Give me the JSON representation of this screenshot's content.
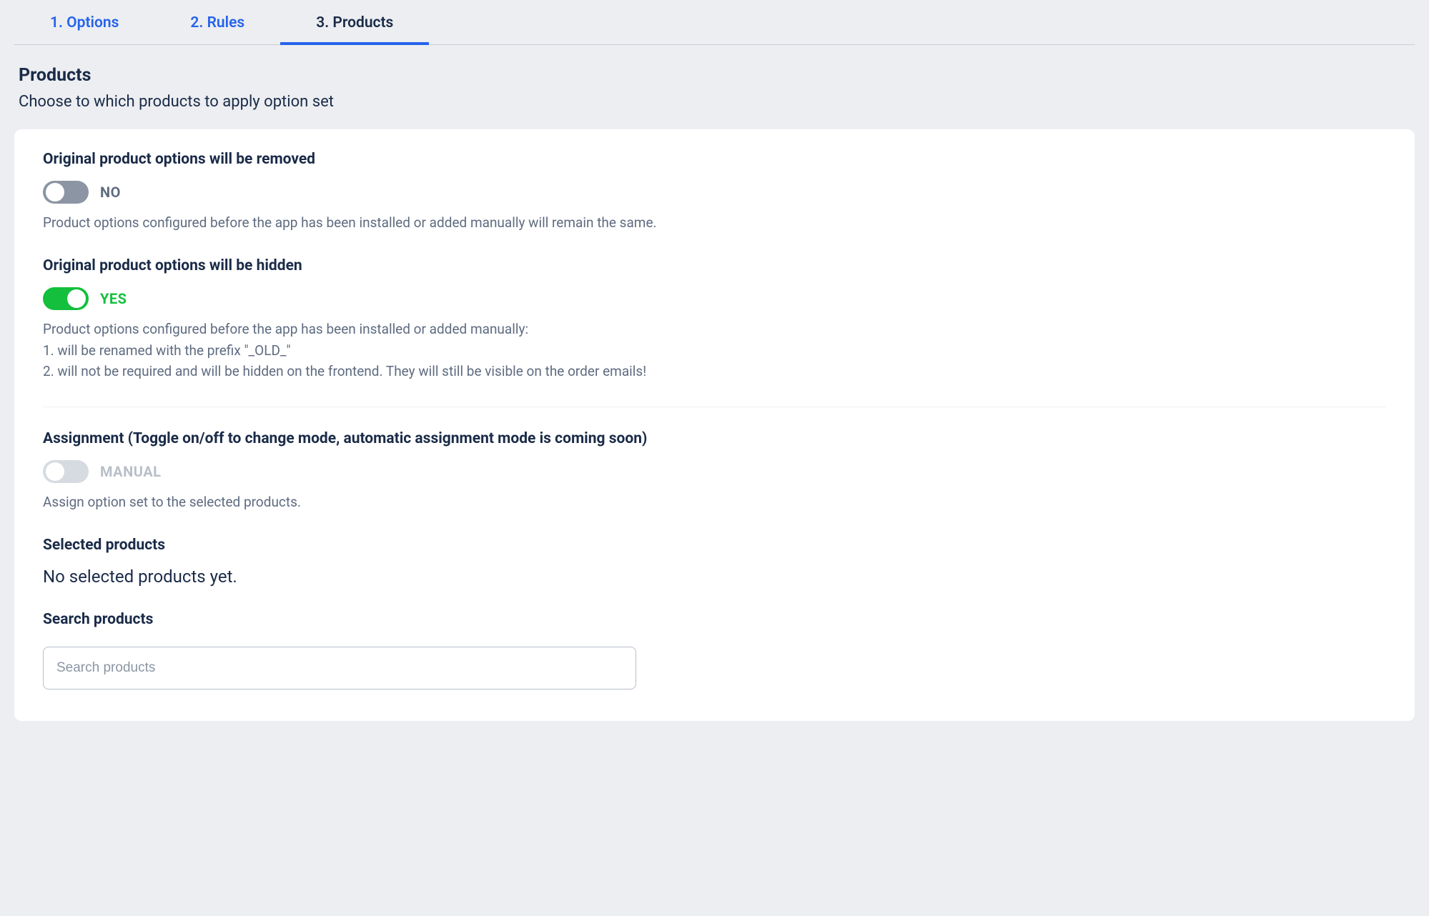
{
  "tabs": [
    {
      "label": "1. Options",
      "active": false
    },
    {
      "label": "2. Rules",
      "active": false
    },
    {
      "label": "3. Products",
      "active": true
    }
  ],
  "page": {
    "title": "Products",
    "subtitle": "Choose to which products to apply option set"
  },
  "remove": {
    "title": "Original product options will be removed",
    "state": "NO",
    "help": "Product options configured before the app has been installed or added manually will remain the same."
  },
  "hide": {
    "title": "Original product options will be hidden",
    "state": "YES",
    "help_intro": "Product options configured before the app has been installed or added manually:",
    "help_1": "1. will be renamed with the prefix \"_OLD_\"",
    "help_2": "2. will not be required and will be hidden on the frontend. They will still be visible on the order emails!"
  },
  "assignment": {
    "title": "Assignment (Toggle on/off to change mode, automatic assignment mode is coming soon)",
    "state": "MANUAL",
    "help": "Assign option set to the selected products."
  },
  "selected": {
    "title": "Selected products",
    "empty": "No selected products yet."
  },
  "search": {
    "title": "Search products",
    "placeholder": "Search products",
    "value": ""
  }
}
